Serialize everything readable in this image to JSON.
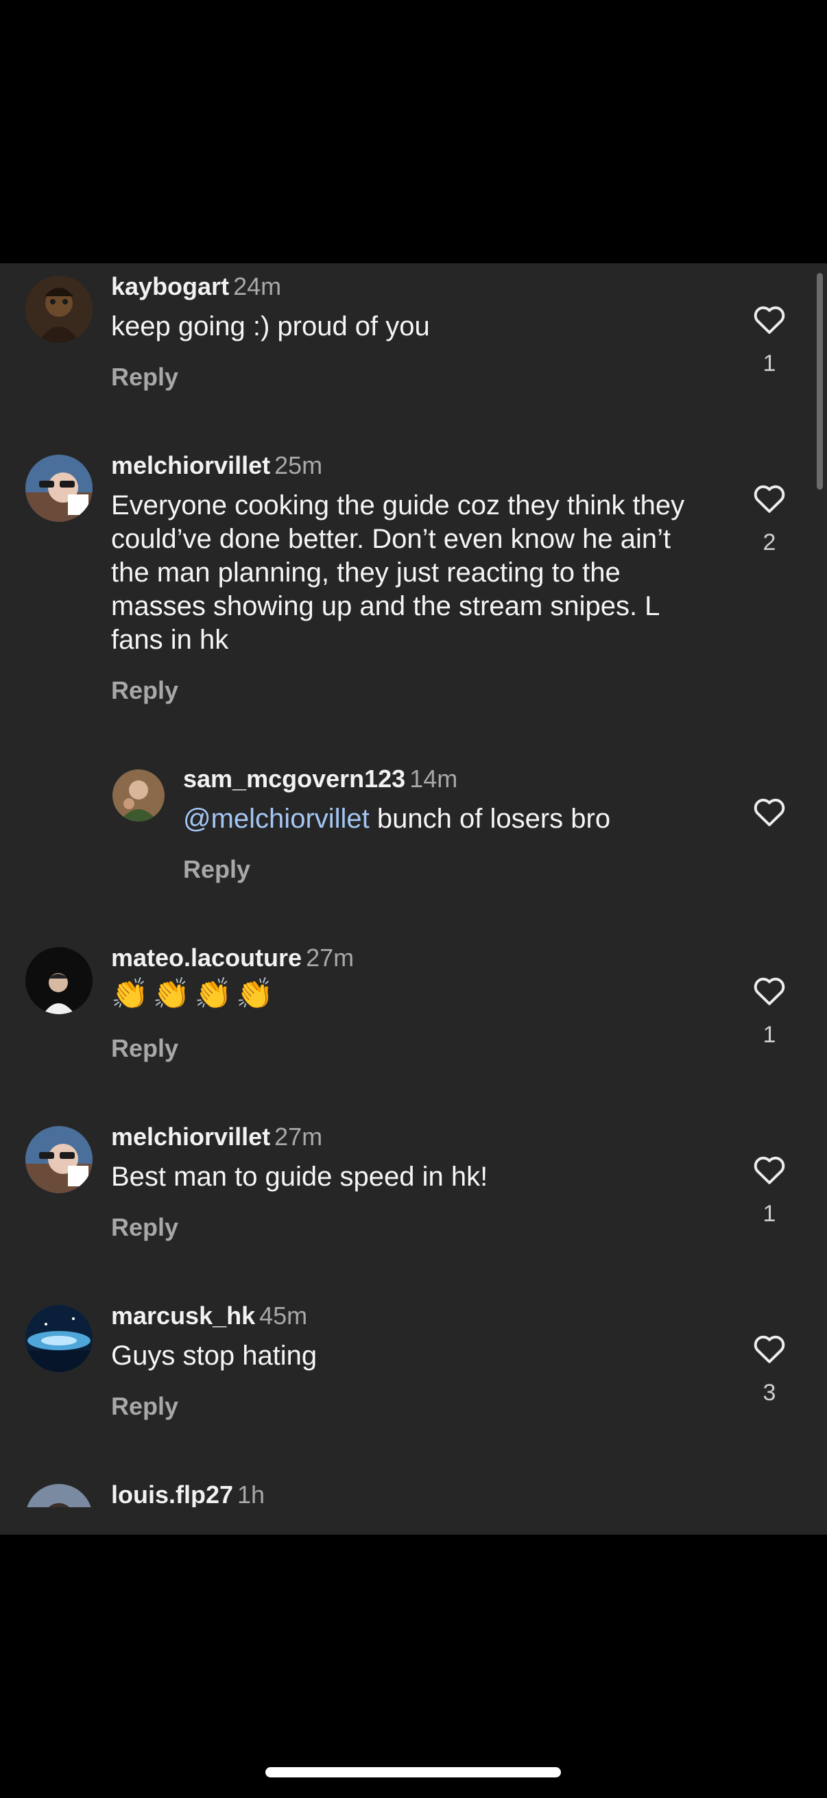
{
  "comments": [
    {
      "username": "kaybogart",
      "time": "24m",
      "text": "keep going :) proud of you",
      "reply_label": "Reply",
      "likes": "1"
    },
    {
      "username": "melchiorvillet",
      "time": "25m",
      "text": "Everyone cooking the guide coz they think they could’ve done better. Don’t even know he ain’t the man planning, they just reacting to the masses showing up and the stream snipes. L fans in hk",
      "reply_label": "Reply",
      "likes": "2"
    },
    {
      "username": "sam_mcgovern123",
      "time": "14m",
      "mention": "@melchiorvillet",
      "text": " bunch of losers bro",
      "reply_label": "Reply",
      "likes": ""
    },
    {
      "username": "mateo.lacouture",
      "time": "27m",
      "text": "👏👏👏👏",
      "reply_label": "Reply",
      "likes": "1"
    },
    {
      "username": "melchiorvillet",
      "time": "27m",
      "text": "Best man to guide speed in hk!",
      "reply_label": "Reply",
      "likes": "1"
    },
    {
      "username": "marcusk_hk",
      "time": "45m",
      "text": "Guys stop hating",
      "reply_label": "Reply",
      "likes": "3"
    },
    {
      "username": "louis.flp27",
      "time": "1h"
    }
  ],
  "icons": {
    "like": "heart-outline-icon"
  },
  "colors": {
    "sheet_bg": "#262626",
    "mention": "#a4c6f4",
    "secondary_text": "#a8a8a8"
  }
}
